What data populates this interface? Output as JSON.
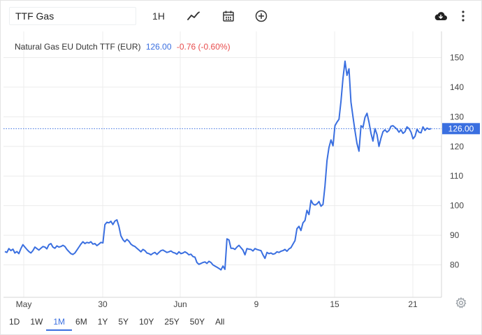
{
  "toolbar": {
    "symbol": "TTF Gas",
    "interval": "1H",
    "icons": [
      "line-chart-icon",
      "calendar-icon",
      "plus-circle-icon",
      "cloud-download-icon",
      "more-vertical-icon"
    ]
  },
  "legend": {
    "name": "Natural Gas EU Dutch TTF (EUR)",
    "last": "126.00",
    "change": "-0.76 (-0.60%)"
  },
  "price_label": "126.00",
  "colors": {
    "line": "#3a6fe0",
    "negative": "#e84c4c",
    "grid": "#ececec",
    "accent": "#3a6fe0"
  },
  "ranges": [
    "1D",
    "1W",
    "1M",
    "6M",
    "1Y",
    "5Y",
    "10Y",
    "25Y",
    "50Y",
    "All"
  ],
  "active_range": "1M",
  "chart_data": {
    "type": "line",
    "title": "Natural Gas EU Dutch TTF (EUR)",
    "x_tick_labels": [
      "May",
      "30",
      "Jun",
      "9",
      "15",
      "21"
    ],
    "y_tick_labels": [
      "80",
      "90",
      "100",
      "110",
      "120",
      "130",
      "140",
      "150"
    ],
    "ylim": [
      72,
      154
    ],
    "grid": true,
    "last_value": 126.0,
    "series": [
      {
        "values": [
          84.5,
          84.2,
          85.5,
          84.8,
          85.3,
          84.0,
          84.5,
          83.8,
          85.5,
          86.8,
          86.0,
          85.2,
          84.5,
          84.0,
          84.8,
          86.0,
          85.5,
          85.0,
          85.6,
          86.2,
          86.0,
          85.4,
          86.8,
          87.2,
          86.0,
          85.6,
          86.4,
          86.0,
          86.2,
          86.6,
          86.2,
          85.2,
          84.5,
          83.8,
          83.5,
          84.0,
          85.0,
          86.0,
          87.0,
          87.8,
          87.2,
          87.6,
          87.4,
          87.8,
          87.0,
          87.2,
          86.5,
          87.0,
          87.6,
          87.4,
          93.6,
          94.4,
          94.2,
          94.7,
          93.6,
          94.8,
          95.2,
          93.0,
          89.8,
          88.5,
          87.8,
          88.6,
          88.0,
          87.0,
          86.5,
          86.2,
          85.6,
          85.0,
          84.4,
          85.2,
          84.8,
          84.0,
          83.8,
          83.4,
          83.9,
          84.2,
          83.5,
          84.2,
          84.8,
          85.0,
          84.6,
          84.2,
          84.4,
          84.7,
          84.2,
          84.0,
          83.6,
          84.4,
          83.8,
          84.0,
          84.4,
          84.0,
          83.4,
          83.6,
          82.8,
          82.6,
          80.8,
          80.2,
          80.5,
          80.8,
          81.0,
          80.5,
          81.2,
          80.8,
          80.0,
          79.6,
          79.2,
          78.8,
          78.3,
          79.6,
          78.5,
          88.8,
          88.4,
          85.6,
          85.6,
          85.2,
          86.0,
          86.6,
          85.8,
          85.0,
          83.4,
          85.5,
          85.3,
          85.2,
          84.7,
          85.5,
          85.2,
          85.0,
          84.8,
          83.4,
          82.2,
          84.2,
          83.8,
          84.0,
          83.6,
          83.8,
          84.4,
          84.2,
          84.6,
          84.8,
          85.2,
          84.6,
          85.4,
          85.8,
          87.0,
          88.2,
          92.2,
          93.0,
          91.6,
          94.2,
          95.0,
          98.4,
          97.0,
          101.8,
          100.6,
          100.2,
          100.6,
          101.4,
          99.8,
          100.4,
          106.6,
          115.2,
          119.6,
          122.2,
          120.2,
          127.0,
          128.2,
          129.2,
          135.2,
          143.0,
          148.8,
          144.0,
          146.2,
          135.0,
          130.0,
          125.2,
          121.0,
          118.4,
          127.0,
          126.4,
          129.8,
          131.2,
          128.2,
          124.4,
          121.8,
          126.0,
          124.0,
          120.0,
          122.8,
          125.0,
          125.6,
          124.8,
          125.4,
          126.8,
          127.0,
          126.4,
          125.8,
          124.8,
          125.6,
          124.4,
          125.0,
          126.6,
          126.0,
          124.8,
          122.6,
          123.4,
          125.8,
          124.8,
          124.6,
          126.6,
          125.4,
          126.2,
          125.8,
          126.0
        ]
      }
    ]
  }
}
